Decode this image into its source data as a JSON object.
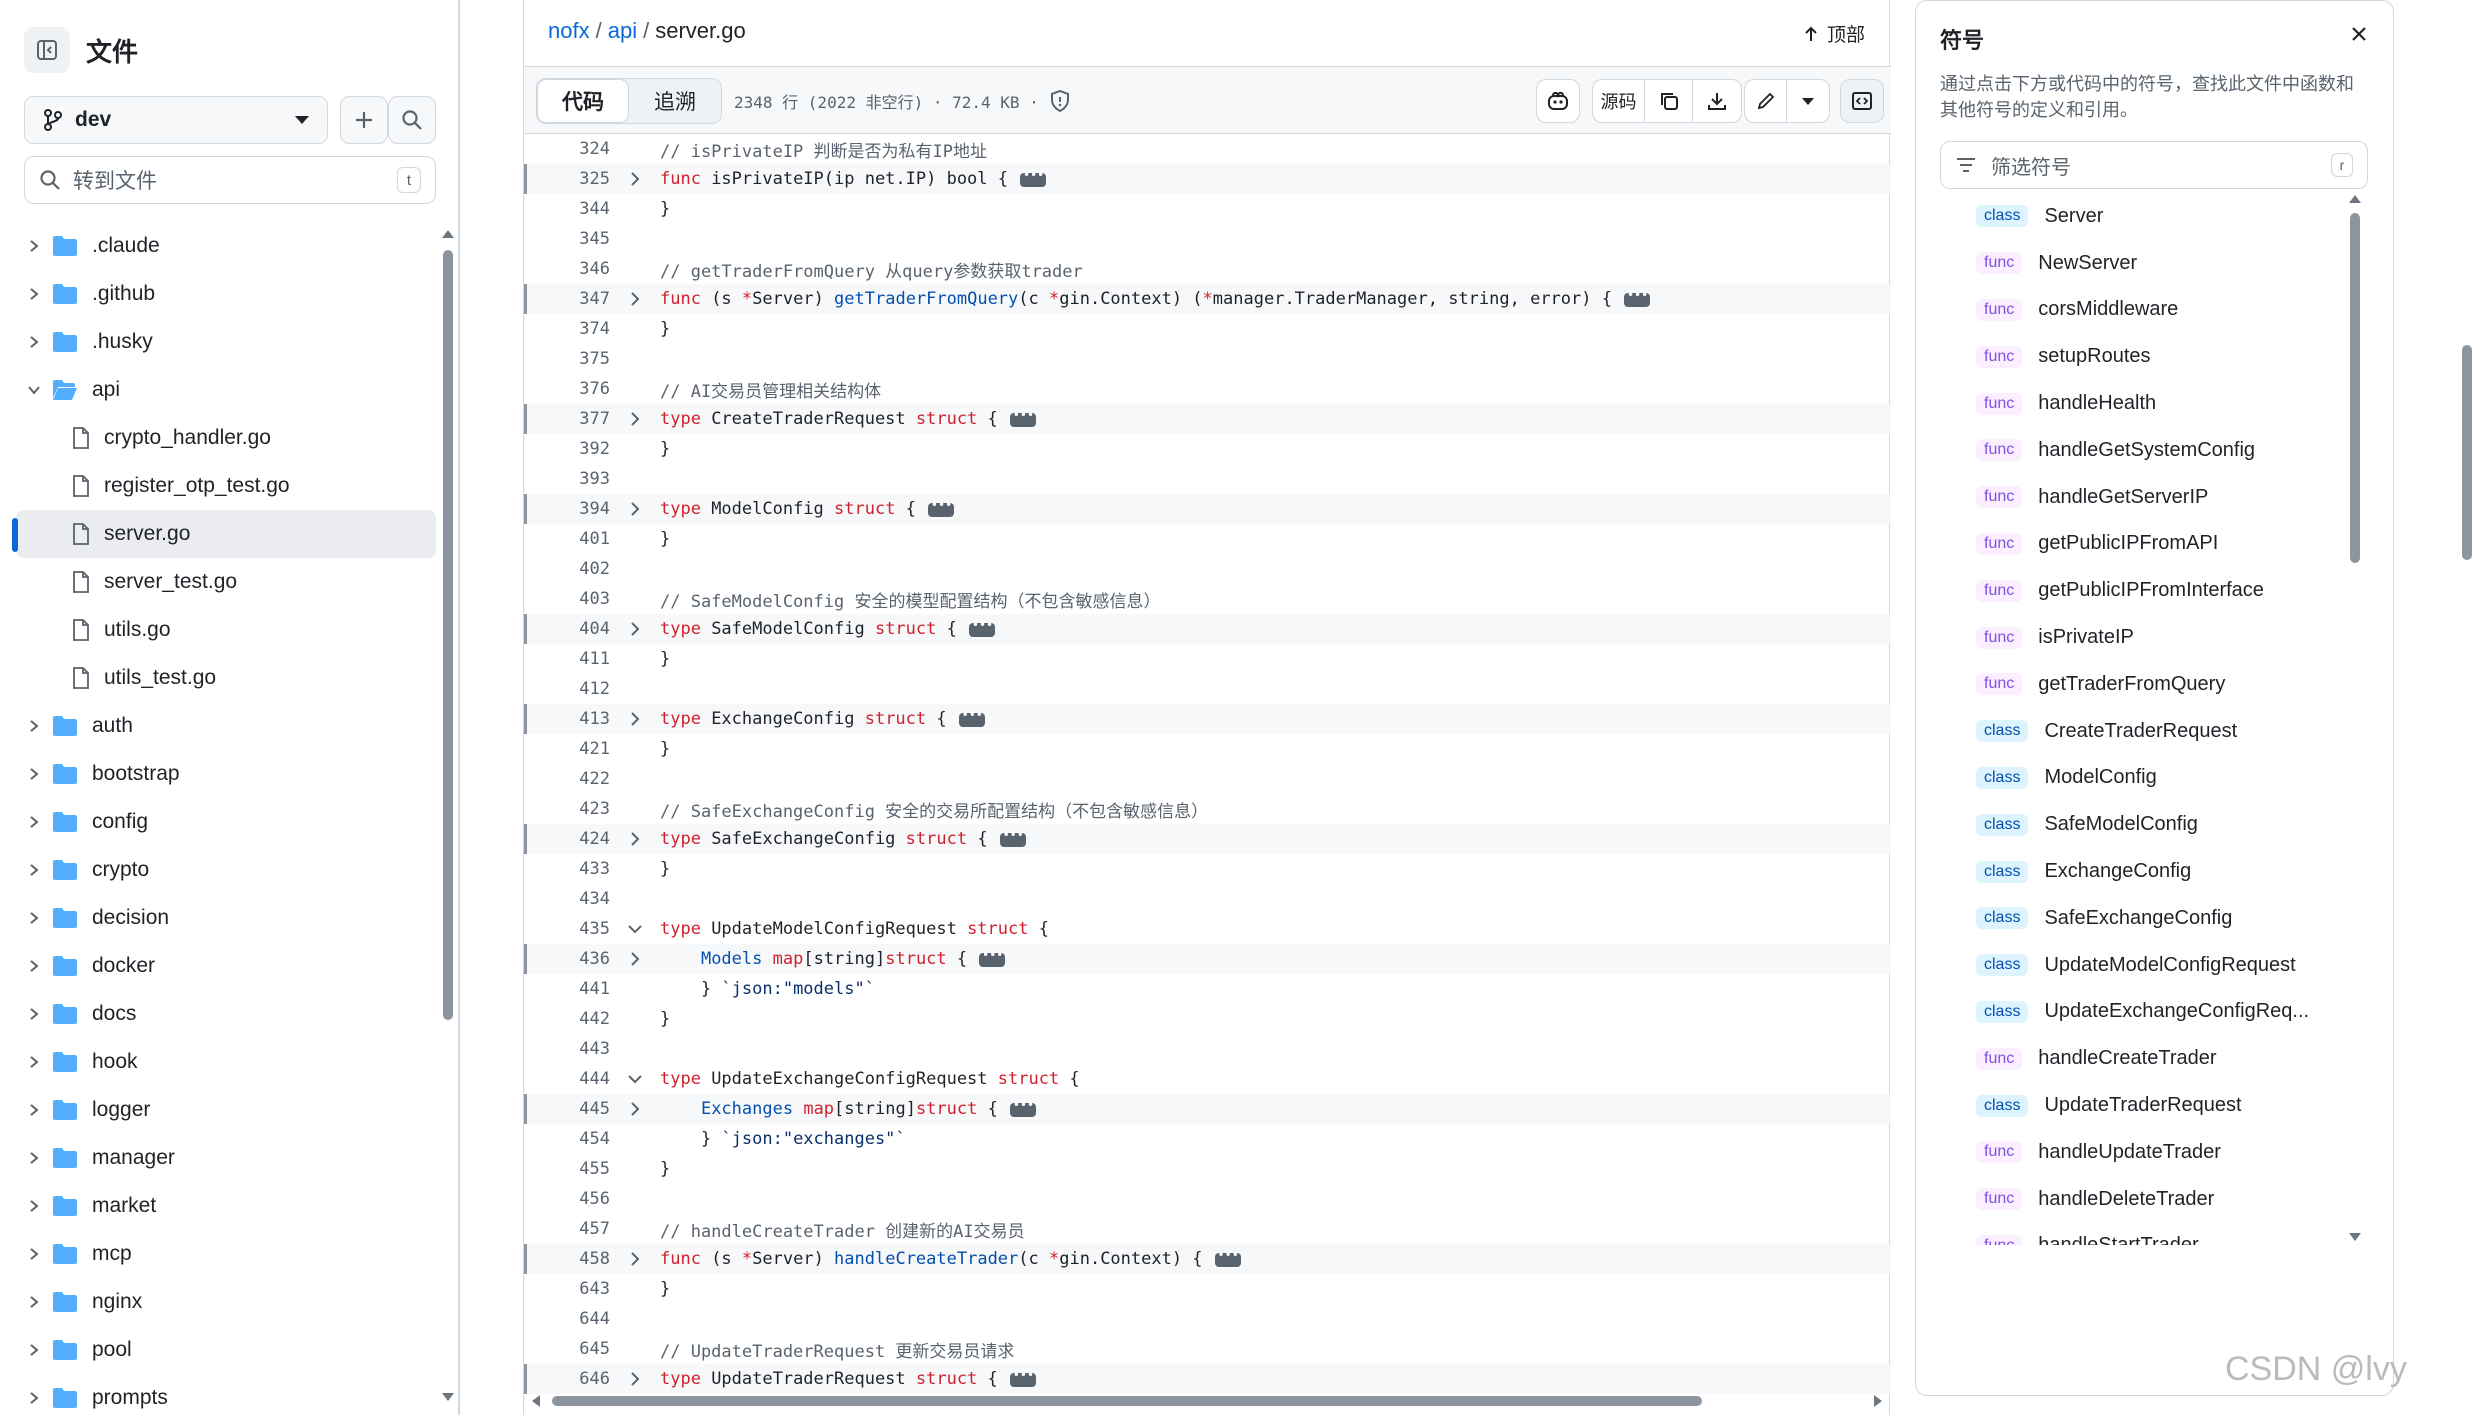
{
  "sidebar": {
    "title": "文件",
    "branch": "dev",
    "goto_placeholder": "转到文件",
    "goto_shortcut": "t",
    "items": [
      {
        "label": ".claude",
        "type": "folder",
        "open": false
      },
      {
        "label": ".github",
        "type": "folder",
        "open": false
      },
      {
        "label": ".husky",
        "type": "folder",
        "open": false
      },
      {
        "label": "api",
        "type": "folder",
        "open": true
      },
      {
        "label": "crypto_handler.go",
        "type": "file"
      },
      {
        "label": "register_otp_test.go",
        "type": "file"
      },
      {
        "label": "server.go",
        "type": "file",
        "selected": true
      },
      {
        "label": "server_test.go",
        "type": "file"
      },
      {
        "label": "utils.go",
        "type": "file"
      },
      {
        "label": "utils_test.go",
        "type": "file"
      },
      {
        "label": "auth",
        "type": "folder",
        "open": false
      },
      {
        "label": "bootstrap",
        "type": "folder",
        "open": false
      },
      {
        "label": "config",
        "type": "folder",
        "open": false
      },
      {
        "label": "crypto",
        "type": "folder",
        "open": false
      },
      {
        "label": "decision",
        "type": "folder",
        "open": false
      },
      {
        "label": "docker",
        "type": "folder",
        "open": false
      },
      {
        "label": "docs",
        "type": "folder",
        "open": false
      },
      {
        "label": "hook",
        "type": "folder",
        "open": false
      },
      {
        "label": "logger",
        "type": "folder",
        "open": false
      },
      {
        "label": "manager",
        "type": "folder",
        "open": false
      },
      {
        "label": "market",
        "type": "folder",
        "open": false
      },
      {
        "label": "mcp",
        "type": "folder",
        "open": false
      },
      {
        "label": "nginx",
        "type": "folder",
        "open": false
      },
      {
        "label": "pool",
        "type": "folder",
        "open": false
      },
      {
        "label": "prompts",
        "type": "folder",
        "open": false
      }
    ]
  },
  "breadcrumb": {
    "repo": "nofx",
    "dir": "api",
    "file": "server.go",
    "sep": "/"
  },
  "top_link": "顶部",
  "toolbar": {
    "tab_code": "代码",
    "tab_blame": "追溯",
    "file_info": "2348 行 (2022 非空行) · 72.4 KB ·",
    "raw_label": "源码"
  },
  "code_lines": [
    {
      "n": "324",
      "html": "<span class='cm'>// isPrivateIP 判断是否为私有IP地址</span>",
      "fold": "",
      "hl": false
    },
    {
      "n": "325",
      "html": "<span class='kw'>func</span> isPrivateIP(ip net.IP) bool {",
      "fold": "right",
      "hl": true,
      "dots": true
    },
    {
      "n": "344",
      "html": "}",
      "fold": "",
      "hl": false
    },
    {
      "n": "345",
      "html": "",
      "fold": "",
      "hl": false
    },
    {
      "n": "346",
      "html": "<span class='cm'>// getTraderFromQuery 从query参数获取trader</span>",
      "fold": "",
      "hl": false
    },
    {
      "n": "347",
      "html": "<span class='kw'>func</span> (s <span class='kw'>*</span>Server) <span class='fn'>getTraderFromQuery</span>(c <span class='kw'>*</span>gin.Context) (<span class='kw'>*</span>manager.TraderManager, string, error) {",
      "fold": "right",
      "hl": true,
      "dots": true
    },
    {
      "n": "374",
      "html": "}",
      "fold": "",
      "hl": false
    },
    {
      "n": "375",
      "html": "",
      "fold": "",
      "hl": false
    },
    {
      "n": "376",
      "html": "<span class='cm'>// AI交易员管理相关结构体</span>",
      "fold": "",
      "hl": false
    },
    {
      "n": "377",
      "html": "<span class='kw'>type</span> CreateTraderRequest <span class='kw'>struct</span> {",
      "fold": "right",
      "hl": true,
      "dots": true
    },
    {
      "n": "392",
      "html": "}",
      "fold": "",
      "hl": false
    },
    {
      "n": "393",
      "html": "",
      "fold": "",
      "hl": false
    },
    {
      "n": "394",
      "html": "<span class='kw'>type</span> ModelConfig <span class='kw'>struct</span> {",
      "fold": "right",
      "hl": true,
      "dots": true
    },
    {
      "n": "401",
      "html": "}",
      "fold": "",
      "hl": false
    },
    {
      "n": "402",
      "html": "",
      "fold": "",
      "hl": false
    },
    {
      "n": "403",
      "html": "<span class='cm'>// SafeModelConfig 安全的模型配置结构（不包含敏感信息）</span>",
      "fold": "",
      "hl": false
    },
    {
      "n": "404",
      "html": "<span class='kw'>type</span> SafeModelConfig <span class='kw'>struct</span> {",
      "fold": "right",
      "hl": true,
      "dots": true
    },
    {
      "n": "411",
      "html": "}",
      "fold": "",
      "hl": false
    },
    {
      "n": "412",
      "html": "",
      "fold": "",
      "hl": false
    },
    {
      "n": "413",
      "html": "<span class='kw'>type</span> ExchangeConfig <span class='kw'>struct</span> {",
      "fold": "right",
      "hl": true,
      "dots": true
    },
    {
      "n": "421",
      "html": "}",
      "fold": "",
      "hl": false
    },
    {
      "n": "422",
      "html": "",
      "fold": "",
      "hl": false
    },
    {
      "n": "423",
      "html": "<span class='cm'>// SafeExchangeConfig 安全的交易所配置结构（不包含敏感信息）</span>",
      "fold": "",
      "hl": false
    },
    {
      "n": "424",
      "html": "<span class='kw'>type</span> SafeExchangeConfig <span class='kw'>struct</span> {",
      "fold": "right",
      "hl": true,
      "dots": true
    },
    {
      "n": "433",
      "html": "}",
      "fold": "",
      "hl": false
    },
    {
      "n": "434",
      "html": "",
      "fold": "",
      "hl": false
    },
    {
      "n": "435",
      "html": "<span class='kw'>type</span> UpdateModelConfigRequest <span class='kw'>struct</span> {",
      "fold": "down",
      "hl": false
    },
    {
      "n": "436",
      "html": "    <span class='ty'>Models</span> <span class='kw'>map</span>[string]<span class='kw'>struct</span> {",
      "fold": "right",
      "hl": true,
      "dots": true
    },
    {
      "n": "441",
      "html": "    } <span class='str'>`json:\"models\"`</span>",
      "fold": "",
      "hl": false
    },
    {
      "n": "442",
      "html": "}",
      "fold": "",
      "hl": false
    },
    {
      "n": "443",
      "html": "",
      "fold": "",
      "hl": false
    },
    {
      "n": "444",
      "html": "<span class='kw'>type</span> UpdateExchangeConfigRequest <span class='kw'>struct</span> {",
      "fold": "down",
      "hl": false
    },
    {
      "n": "445",
      "html": "    <span class='ty'>Exchanges</span> <span class='kw'>map</span>[string]<span class='kw'>struct</span> {",
      "fold": "right",
      "hl": true,
      "dots": true
    },
    {
      "n": "454",
      "html": "    } <span class='str'>`json:\"exchanges\"`</span>",
      "fold": "",
      "hl": false
    },
    {
      "n": "455",
      "html": "}",
      "fold": "",
      "hl": false
    },
    {
      "n": "456",
      "html": "",
      "fold": "",
      "hl": false
    },
    {
      "n": "457",
      "html": "<span class='cm'>// handleCreateTrader 创建新的AI交易员</span>",
      "fold": "",
      "hl": false
    },
    {
      "n": "458",
      "html": "<span class='kw'>func</span> (s <span class='kw'>*</span>Server) <span class='fn'>handleCreateTrader</span>(c <span class='kw'>*</span>gin.Context) {",
      "fold": "right",
      "hl": true,
      "dots": true
    },
    {
      "n": "643",
      "html": "}",
      "fold": "",
      "hl": false
    },
    {
      "n": "644",
      "html": "",
      "fold": "",
      "hl": false
    },
    {
      "n": "645",
      "html": "<span class='cm'>// UpdateTraderRequest 更新交易员请求</span>",
      "fold": "",
      "hl": false
    },
    {
      "n": "646",
      "html": "<span class='kw'>type</span> UpdateTraderRequest <span class='kw'>struct</span> {",
      "fold": "right",
      "hl": true,
      "dots": true
    }
  ],
  "symbols": {
    "title": "符号",
    "description": "通过点击下方或代码中的符号，查找此文件中函数和其他符号的定义和引用。",
    "filter_placeholder": "筛选符号",
    "filter_shortcut": "r",
    "items": [
      {
        "kind": "class",
        "name": "Server"
      },
      {
        "kind": "func",
        "name": "NewServer"
      },
      {
        "kind": "func",
        "name": "corsMiddleware"
      },
      {
        "kind": "func",
        "name": "setupRoutes"
      },
      {
        "kind": "func",
        "name": "handleHealth"
      },
      {
        "kind": "func",
        "name": "handleGetSystemConfig"
      },
      {
        "kind": "func",
        "name": "handleGetServerIP"
      },
      {
        "kind": "func",
        "name": "getPublicIPFromAPI"
      },
      {
        "kind": "func",
        "name": "getPublicIPFromInterface"
      },
      {
        "kind": "func",
        "name": "isPrivateIP"
      },
      {
        "kind": "func",
        "name": "getTraderFromQuery"
      },
      {
        "kind": "class",
        "name": "CreateTraderRequest"
      },
      {
        "kind": "class",
        "name": "ModelConfig"
      },
      {
        "kind": "class",
        "name": "SafeModelConfig"
      },
      {
        "kind": "class",
        "name": "ExchangeConfig"
      },
      {
        "kind": "class",
        "name": "SafeExchangeConfig"
      },
      {
        "kind": "class",
        "name": "UpdateModelConfigRequest"
      },
      {
        "kind": "class",
        "name": "UpdateExchangeConfigReq..."
      },
      {
        "kind": "func",
        "name": "handleCreateTrader"
      },
      {
        "kind": "class",
        "name": "UpdateTraderRequest"
      },
      {
        "kind": "func",
        "name": "handleUpdateTrader"
      },
      {
        "kind": "func",
        "name": "handleDeleteTrader"
      },
      {
        "kind": "func",
        "name": "handleStartTrader"
      }
    ]
  },
  "watermark": "CSDN @lvy",
  "colors": {
    "accent": "#0969da",
    "keyword": "#cf222e",
    "function": "#0550ae",
    "comment": "#59636e"
  }
}
